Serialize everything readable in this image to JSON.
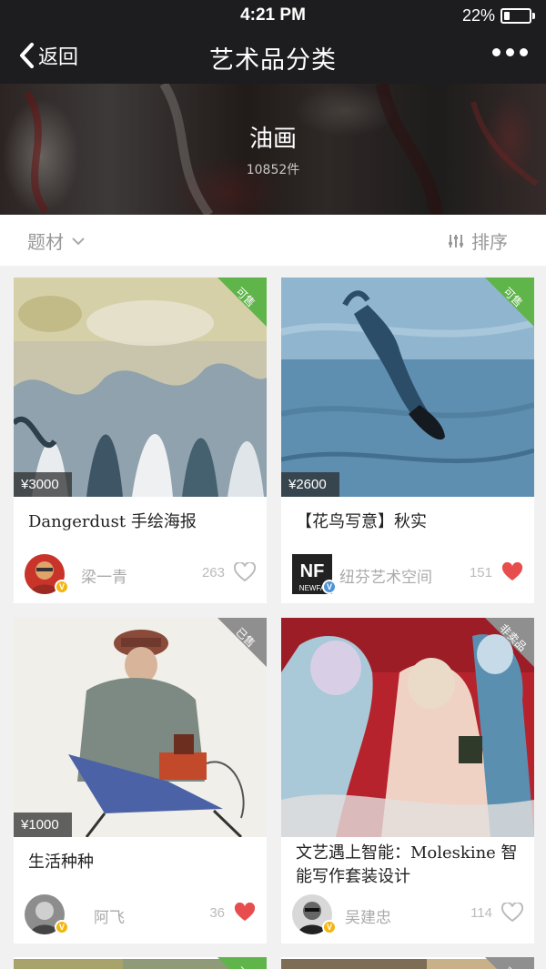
{
  "status_bar": {
    "time": "4:21 PM",
    "battery": "22%",
    "battery_level": 0.22
  },
  "nav": {
    "back_label": "返回",
    "title": "艺术品分类",
    "more_icon": "more-dots-icon"
  },
  "banner": {
    "title": "油画",
    "count": "10852件"
  },
  "filter": {
    "subject_label": "题材",
    "sort_label": "排序"
  },
  "colors": {
    "sold_badge": "#5fb44a",
    "unsold_badge": "#8f8f8f",
    "liked_heart": "#e84d4d"
  },
  "cards": [
    {
      "price": "¥3000",
      "status": "可售",
      "title": "Dangerdust 手绘海报",
      "author": "梁一青",
      "likes": "263",
      "liked": false,
      "badge": "V"
    },
    {
      "price": "¥2600",
      "status": "可售",
      "title": "【花鸟写意】秋实",
      "author": "纽芬艺术空间",
      "likes": "151",
      "liked": true,
      "badge": "V",
      "avatar_text": "NEWFA"
    },
    {
      "price": "¥1000",
      "status": "已售",
      "title": "生活种种",
      "author": "阿飞",
      "likes": "36",
      "liked": true,
      "badge": "V"
    },
    {
      "status": "非卖品",
      "title": "文艺遇上智能：Moleskine 智能写作套装设计",
      "author": "吴建忠",
      "likes": "114",
      "liked": false,
      "badge": "V"
    },
    {
      "status": "可售"
    },
    {
      "status": "已售"
    }
  ]
}
